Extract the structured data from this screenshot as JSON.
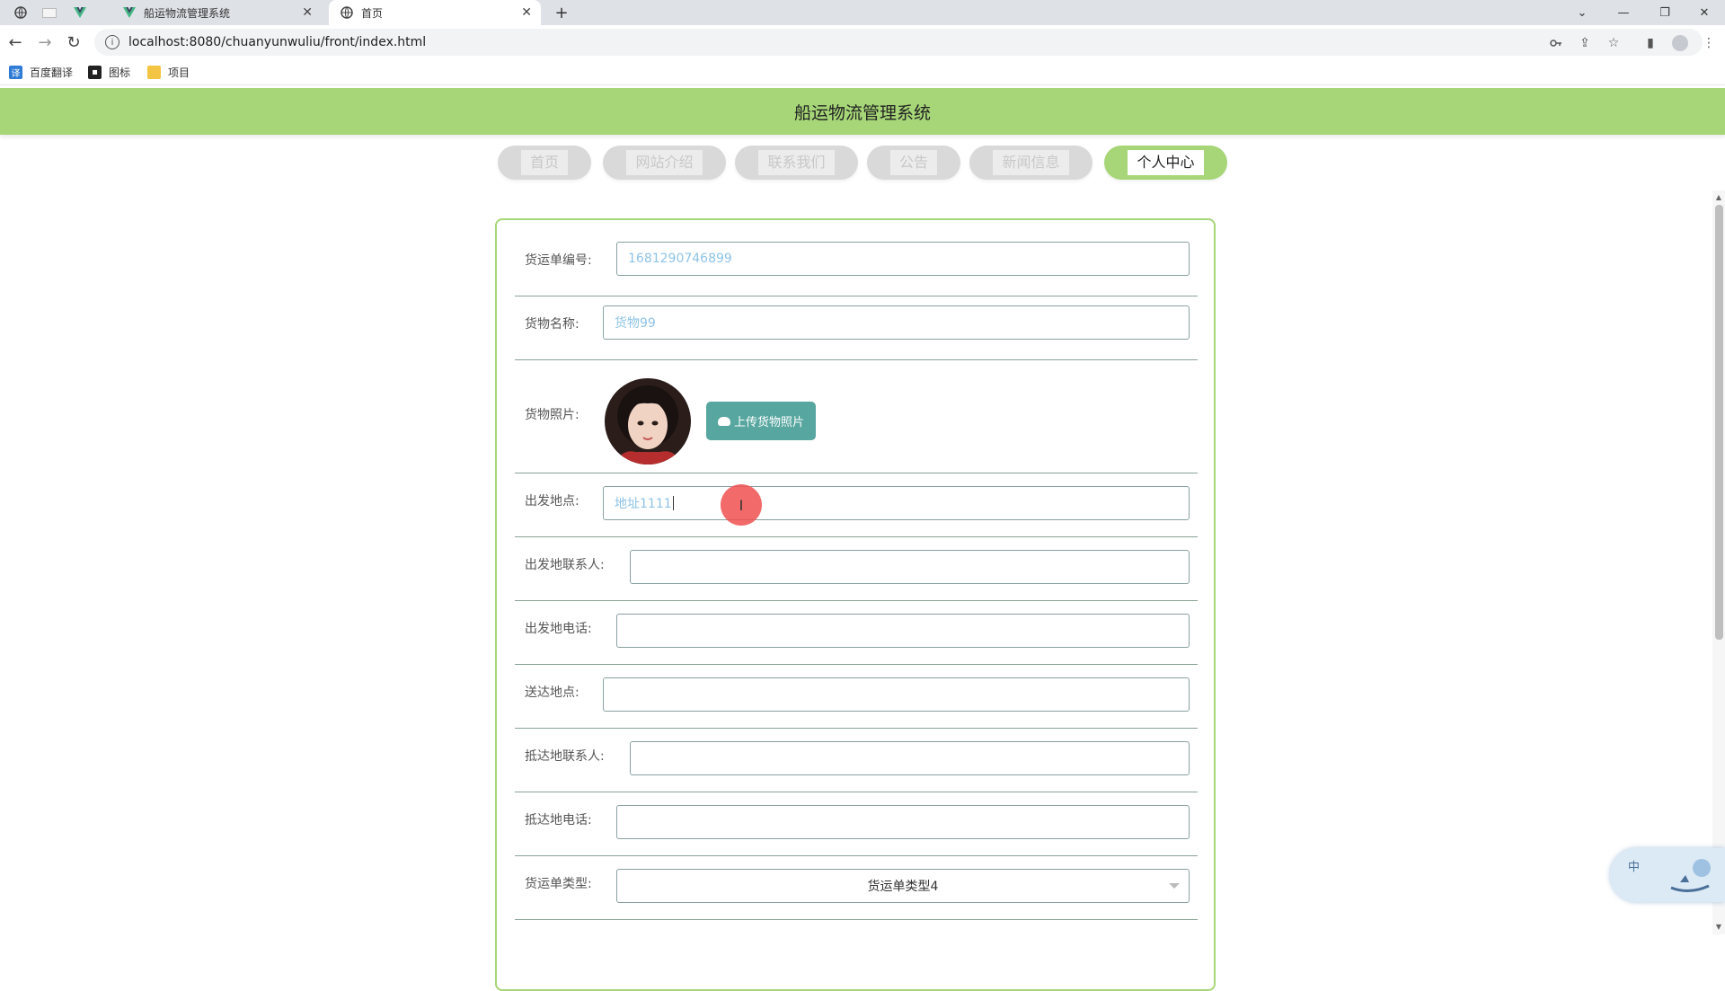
{
  "browser": {
    "tabs": [
      {
        "title": "船运物流管理系统",
        "active": false
      },
      {
        "title": "首页",
        "active": true
      }
    ],
    "new_tab_symbol": "+",
    "url": "localhost:8080/chuanyunwuliu/front/index.html",
    "bookmarks": [
      {
        "label": "百度翻译",
        "icon": "translate-icon"
      },
      {
        "label": "图标",
        "icon": "image-icon"
      },
      {
        "label": "项目",
        "icon": "folder-icon"
      }
    ]
  },
  "site": {
    "title": "船运物流管理系统",
    "nav": [
      "首页",
      "网站介绍",
      "联系我们",
      "公告",
      "新闻信息",
      "个人中心"
    ],
    "active_nav": "个人中心"
  },
  "form": {
    "fields": {
      "order_no": {
        "label": "货运单编号:",
        "value": "1681290746899"
      },
      "goods_name": {
        "label": "货物名称:",
        "value": "货物99"
      },
      "goods_photo": {
        "label": "货物照片:",
        "button": "上传货物照片"
      },
      "origin": {
        "label": "出发地点:",
        "value": "地址1111"
      },
      "origin_contact": {
        "label": "出发地联系人:",
        "value": ""
      },
      "origin_phone": {
        "label": "出发地电话:",
        "value": ""
      },
      "destination": {
        "label": "送达地点:",
        "value": ""
      },
      "dest_contact": {
        "label": "抵达地联系人:",
        "value": ""
      },
      "dest_phone": {
        "label": "抵达地电话:",
        "value": ""
      },
      "order_type": {
        "label": "货运单类型:",
        "value": "货运单类型4"
      }
    }
  },
  "widget": {
    "lang": "中"
  },
  "colors": {
    "header_green": "#a6d677",
    "upload_button": "#57a69f",
    "input_text": "#8ec3e6"
  }
}
